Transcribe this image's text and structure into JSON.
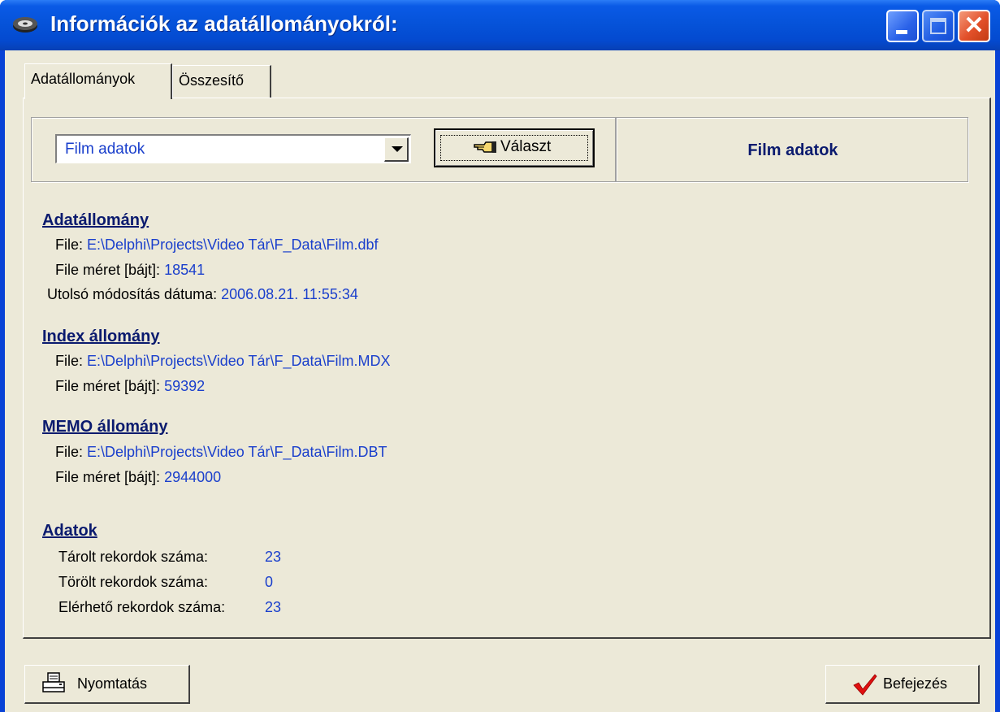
{
  "window": {
    "title": "Információk az adatállományokról:"
  },
  "tabs": [
    {
      "label": "Adatállományok",
      "active": true
    },
    {
      "label": "Összesítő",
      "active": false
    }
  ],
  "selector": {
    "combo_value": "Film adatok",
    "select_button_label": "Választ",
    "current_title": "Film adatok"
  },
  "data_file": {
    "heading": "Adatállomány",
    "file_label": "File:",
    "file_value": "E:\\Delphi\\Projects\\Video Tár\\F_Data\\Film.dbf",
    "size_label": "File méret [bájt]:",
    "size_value": "18541",
    "modified_label": "Utolsó módosítás dátuma:",
    "modified_value": "2006.08.21. 11:55:34"
  },
  "index_file": {
    "heading": "Index állomány",
    "file_label": "File:",
    "file_value": "E:\\Delphi\\Projects\\Video Tár\\F_Data\\Film.MDX",
    "size_label": "File méret [bájt]:",
    "size_value": "59392"
  },
  "memo_file": {
    "heading": "MEMO állomány",
    "file_label": "File:",
    "file_value": "E:\\Delphi\\Projects\\Video Tár\\F_Data\\Film.DBT",
    "size_label": "File méret [bájt]:",
    "size_value": "2944000"
  },
  "records": {
    "heading": "Adatok",
    "stored_label": "Tárolt rekordok száma:",
    "stored_value": "23",
    "deleted_label": "Törölt rekordok száma:",
    "deleted_value": "0",
    "available_label": "Elérhető rekordok száma:",
    "available_value": "23"
  },
  "footer": {
    "print_label": "Nyomtatás",
    "finish_label": "Befejezés"
  },
  "colors": {
    "title_bar": "#0552d8",
    "face": "#ece9d8",
    "value_text": "#1a3fcc",
    "heading_text": "#0a1a6e",
    "close_button": "#e2502a",
    "check_mark": "#e01010"
  },
  "icons": [
    "app-icon",
    "minimize-icon",
    "maximize-icon",
    "close-icon",
    "pointing-hand-icon",
    "dropdown-arrow-icon",
    "printer-icon",
    "checkmark-icon"
  ]
}
